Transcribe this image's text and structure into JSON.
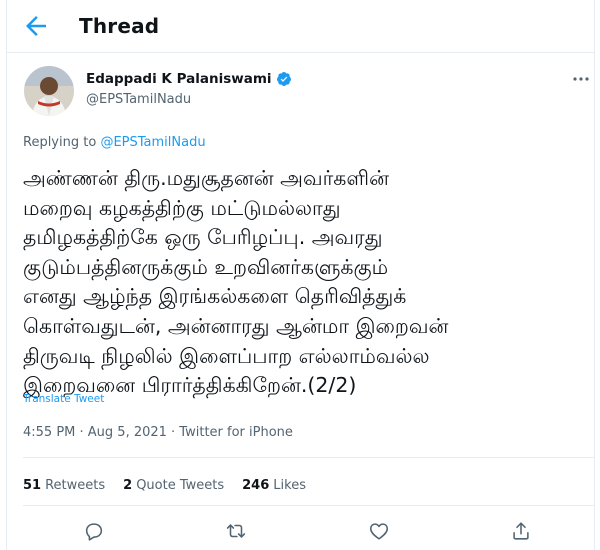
{
  "header": {
    "title": "Thread",
    "back_icon": "arrow-left-icon"
  },
  "author": {
    "name": "Edappadi K Palaniswami",
    "handle": "@EPSTamilNadu",
    "verified_icon": "verified-badge-icon",
    "more_icon": "more-icon"
  },
  "replying": {
    "prefix": "Replying to ",
    "handle": "@EPSTamilNadu"
  },
  "tweet": {
    "text": "அண்ணன் திரு.மதுசூதனன் அவர்களின்\nமறைவு கழகத்திற்கு மட்டுமல்லாது\nதமிழகத்திற்கே ஒரு பேரிழப்பு. அவரது\nகுடும்பத்தினருக்கும் உறவினர்களுக்கும்\nஎனது ஆழ்ந்த இரங்கல்களை தெரிவித்துக்\nகொள்வதுடன், அன்னாரது ஆன்மா இறைவன்\nதிருவடி நிழலில் இளைப்பாற எல்லாம்வல்ல\nஇறைவனை பிரார்த்திக்கிறேன்.(2/2)",
    "translate_label": "Translate Tweet",
    "timestamp": "4:55 PM · Aug 5, 2021 · Twitter for iPhone"
  },
  "stats": {
    "retweets_count": "51",
    "retweets_label": "Retweets",
    "quotes_count": "2",
    "quotes_label": "Quote Tweets",
    "likes_count": "246",
    "likes_label": "Likes"
  },
  "actions": [
    "reply-icon",
    "retweet-icon",
    "like-icon",
    "share-icon"
  ],
  "colors": {
    "accent": "#1d9bf0",
    "secondary_text": "#536471",
    "border": "#e6ecf0"
  }
}
